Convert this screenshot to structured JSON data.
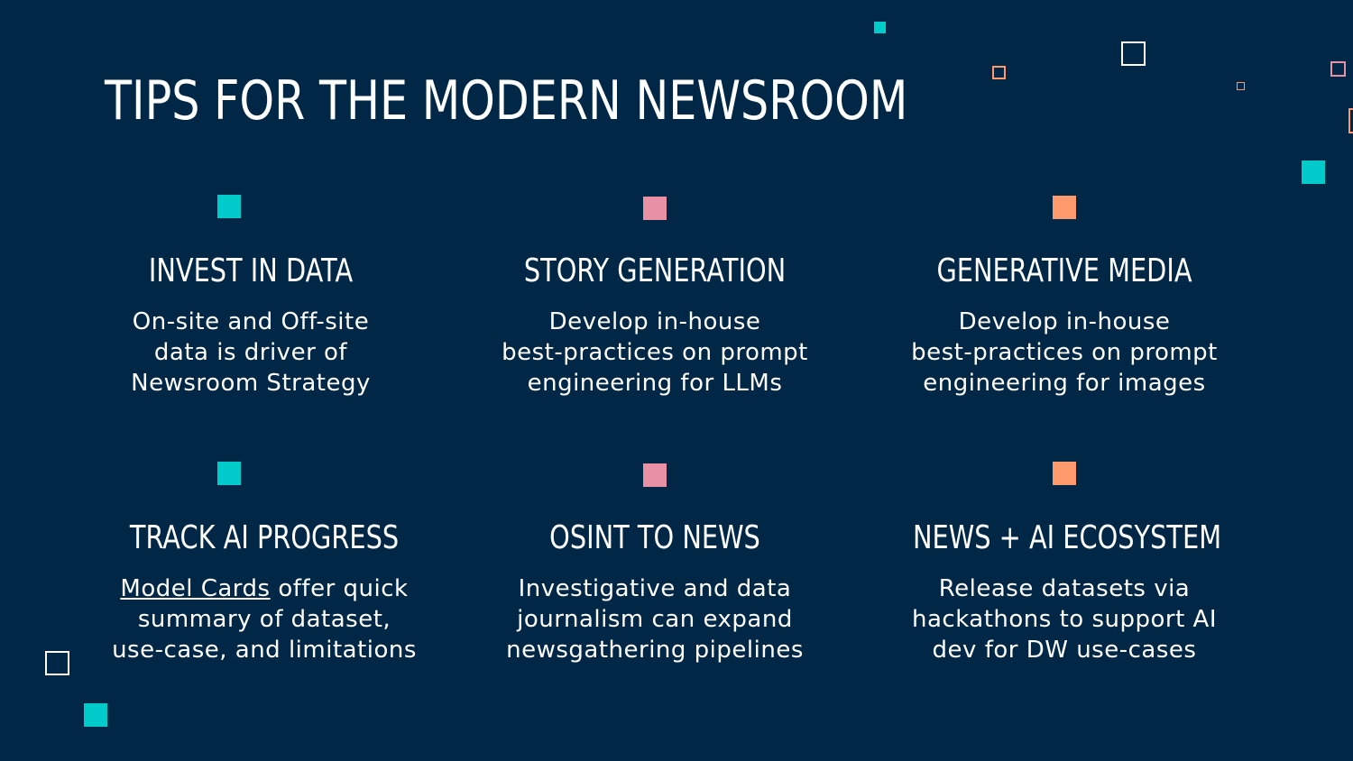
{
  "title": "TIPS FOR THE MODERN NEWSROOM",
  "colors": {
    "background": "#002846",
    "teal": "#00CBCB",
    "pink": "#E891A4",
    "orange": "#FF9A6E",
    "white": "#FFFFFF"
  },
  "cards": [
    {
      "heading": "INVEST IN DATA",
      "marker_color": "teal",
      "lines": [
        "On-site and Off-site",
        "data is driver of",
        "Newsroom Strategy"
      ]
    },
    {
      "heading": "STORY GENERATION",
      "marker_color": "pink",
      "lines": [
        "Develop in-house",
        "best-practices on prompt",
        "engineering for LLMs"
      ]
    },
    {
      "heading": "GENERATIVE MEDIA",
      "marker_color": "orange",
      "lines": [
        "Develop in-house",
        "best-practices on prompt",
        "engineering for images"
      ]
    },
    {
      "heading": "TRACK AI PROGRESS",
      "marker_color": "teal",
      "link_text": "Model Cards",
      "line1_rest": " offer quick",
      "lines": [
        "summary of dataset,",
        "use-case, and limitations"
      ]
    },
    {
      "heading": "OSINT TO NEWS",
      "marker_color": "pink",
      "lines": [
        "Investigative and data",
        "journalism can expand",
        "newsgathering pipelines"
      ]
    },
    {
      "heading": "NEWS + AI ECOSYSTEM",
      "marker_color": "orange",
      "lines": [
        "Release datasets via",
        "hackathons to support AI",
        "dev for DW use-cases"
      ]
    }
  ]
}
